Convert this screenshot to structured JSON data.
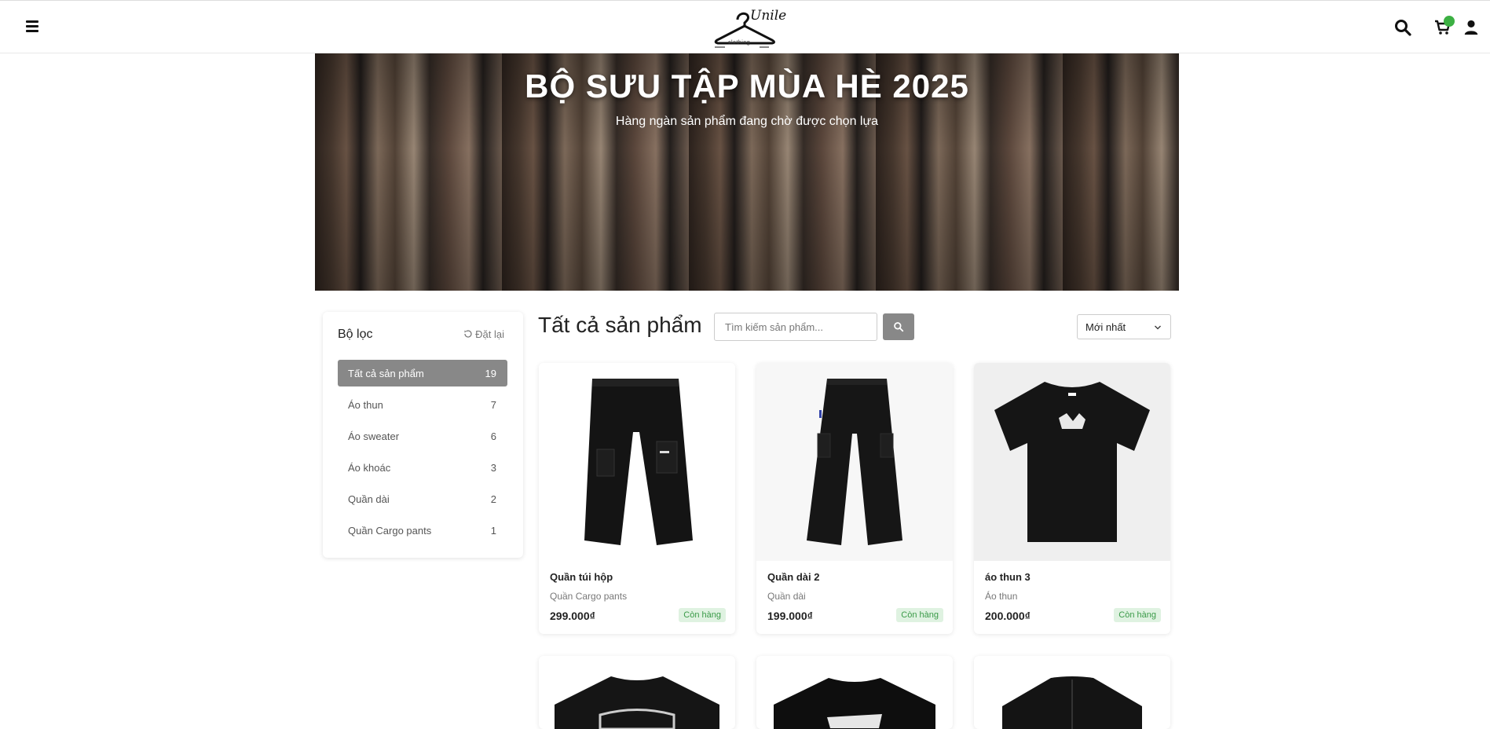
{
  "header": {
    "logo_script": "Unile",
    "logo_sub": "clothing",
    "cart_badge_color": "#3cb043"
  },
  "banner": {
    "title": "BỘ SƯU TẬP MÙA HÈ 2025",
    "subtitle": "Hàng ngàn sản phẩm đang chờ được chọn lựa"
  },
  "filter": {
    "title": "Bộ lọc",
    "reset_label": "Đặt lại",
    "categories": [
      {
        "name": "Tất cả sản phẩm",
        "count": "19",
        "active": true
      },
      {
        "name": "Áo thun",
        "count": "7"
      },
      {
        "name": "Áo sweater",
        "count": "6"
      },
      {
        "name": "Áo khoác",
        "count": "3"
      },
      {
        "name": "Quần dài",
        "count": "2"
      },
      {
        "name": "Quần Cargo pants",
        "count": "1"
      }
    ]
  },
  "toolbar": {
    "title": "Tất cả sản phẩm",
    "search_placeholder": "Tìm kiếm sản phẩm...",
    "sort_value": "Mới nhất"
  },
  "products": [
    {
      "name": "Quần túi hộp",
      "category": "Quần Cargo pants",
      "price": "299.000₫",
      "stock": "Còn hàng"
    },
    {
      "name": "Quần dài 2",
      "category": "Quần dài",
      "price": "199.000₫",
      "stock": "Còn hàng"
    },
    {
      "name": "áo thun 3",
      "category": "Áo thun",
      "price": "200.000₫",
      "stock": "Còn hàng"
    }
  ],
  "icons": [
    "hamburger-menu-icon",
    "hanger-logo-icon",
    "search-icon",
    "cart-icon",
    "user-icon",
    "reset-icon",
    "chevron-down-icon"
  ]
}
